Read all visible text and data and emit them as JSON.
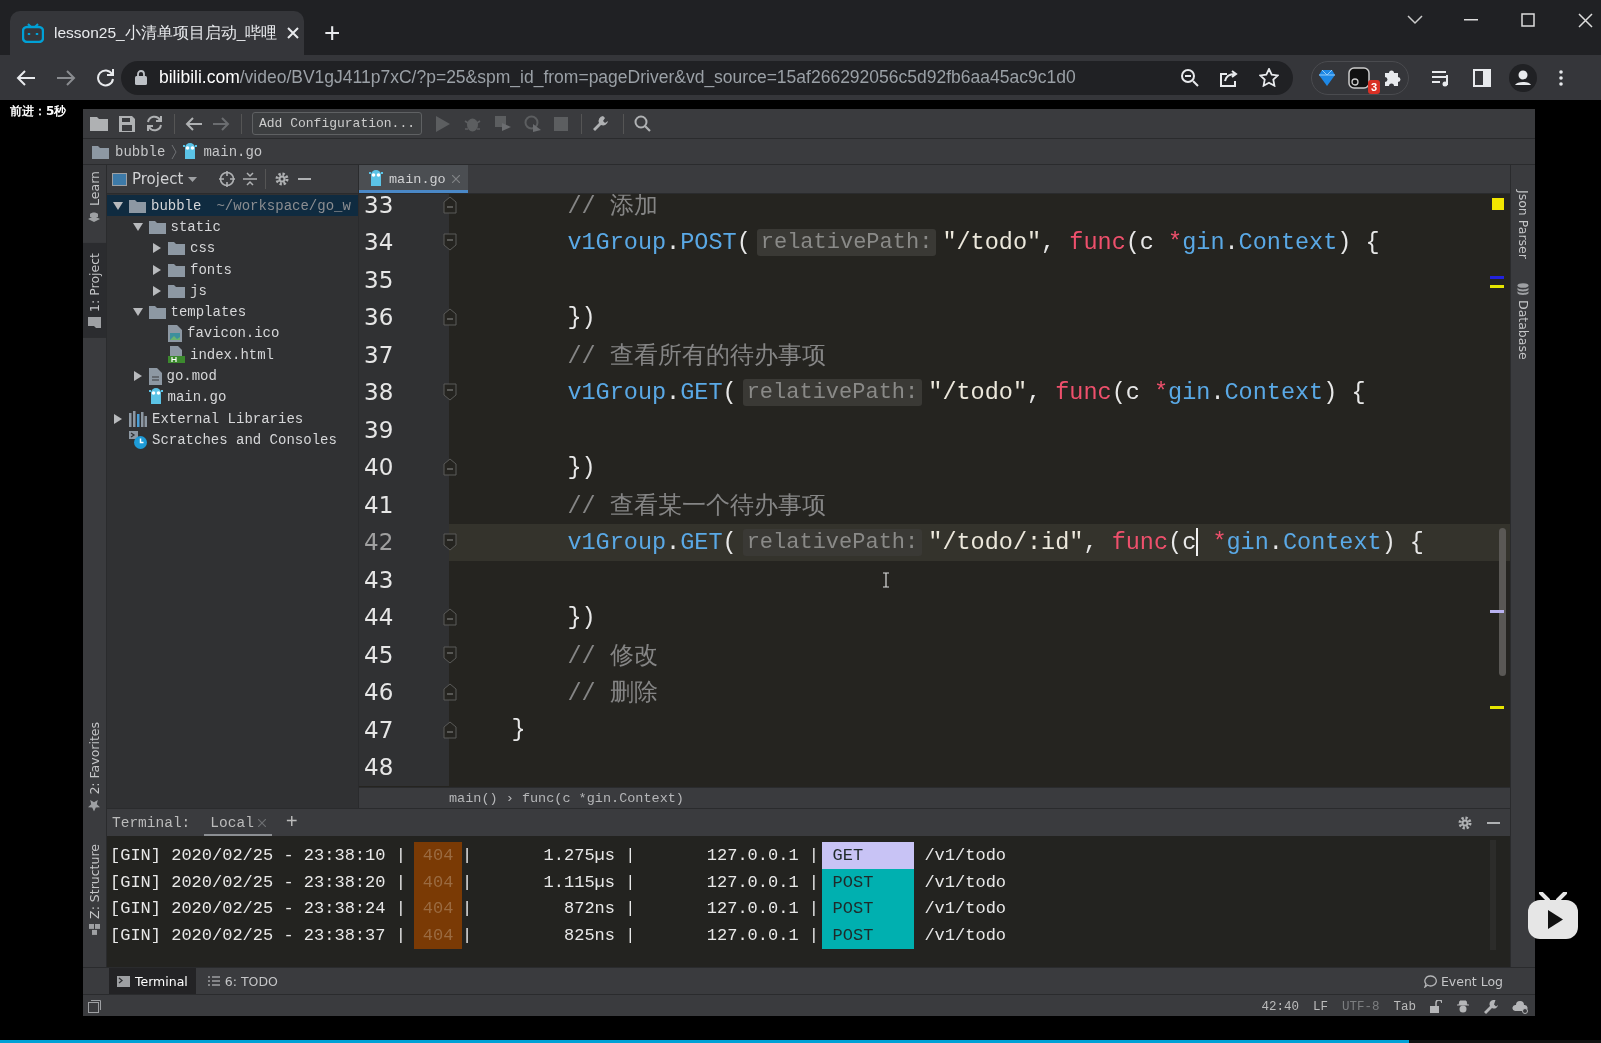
{
  "browser": {
    "tabs": [
      {
        "title": "lesson25_小清单项目启动_哔哩",
        "selected": true
      }
    ],
    "new_tab": "+",
    "address": {
      "domain": "bilibili.com",
      "path": "/video/BV1gJ411p7xC/?p=25&spm_id_from=pageDriver&vd_source=15af266292056c5d92fb6aa45ac9c1d0"
    },
    "extension_badge": "3"
  },
  "player": {
    "seek_hint": "前进：5秒",
    "progress": {
      "level": 0.88
    }
  },
  "ide": {
    "toolbar": {
      "run_config": "Add Configuration..."
    },
    "breadcrumb": [
      "bubble",
      "main.go"
    ],
    "left_tools_top": [
      {
        "label": "Learn",
        "selected": false
      },
      {
        "label": "1: Project",
        "selected": true
      }
    ],
    "left_tools_bottom": [
      {
        "label": "2: Favorites",
        "selected": false
      },
      {
        "label": "Z: Structure",
        "selected": false
      }
    ],
    "right_tools": [
      "Json Parser",
      "Database"
    ],
    "project": {
      "title": "Project",
      "tree": [
        {
          "name": "bubble",
          "kind": "folder",
          "path": "~/workspace/go_w",
          "expanded": true,
          "selected": true,
          "children": [
            {
              "name": "static",
              "kind": "folder",
              "expanded": true,
              "selected": false,
              "children": [
                {
                  "name": "css",
                  "kind": "folder",
                  "expanded": false,
                  "selected": false
                },
                {
                  "name": "fonts",
                  "kind": "folder",
                  "expanded": false,
                  "selected": false
                },
                {
                  "name": "js",
                  "kind": "folder",
                  "expanded": false,
                  "selected": false
                }
              ]
            },
            {
              "name": "templates",
              "kind": "folder",
              "expanded": true,
              "selected": false,
              "children": [
                {
                  "name": "favicon.ico",
                  "kind": "image",
                  "selected": false
                },
                {
                  "name": "index.html",
                  "kind": "html",
                  "selected": false
                }
              ]
            },
            {
              "name": "go.mod",
              "kind": "mod",
              "expanded": false,
              "selected": false
            },
            {
              "name": "main.go",
              "kind": "go",
              "selected": false
            }
          ]
        },
        {
          "name": "External Libraries",
          "kind": "library",
          "expanded": false,
          "selected": false
        },
        {
          "name": "Scratches and Consoles",
          "kind": "scratches",
          "selected": false
        }
      ]
    },
    "editor": {
      "tabs": [
        {
          "label": "main.go",
          "selected": true
        }
      ],
      "lines": [
        {
          "number": "33",
          "current": false,
          "fold_start": false,
          "fold_end": true,
          "kind": "nested",
          "tokens": [
            {
              "kind": "comment",
              "text": "// 添加"
            }
          ]
        },
        {
          "number": "34",
          "current": false,
          "fold_start": true,
          "fold_end": false,
          "kind": "nested",
          "tokens": [
            {
              "kind": "ident",
              "text": "v1Group"
            },
            {
              "kind": "punct",
              "text": "."
            },
            {
              "kind": "ident",
              "text": "POST"
            },
            {
              "kind": "punct",
              "text": "("
            },
            {
              "kind": "hint",
              "text": "relativePath:"
            },
            {
              "kind": "string",
              "text": "\"/todo\""
            },
            {
              "kind": "punct",
              "text": ", "
            },
            {
              "kind": "keyword",
              "text": "func"
            },
            {
              "kind": "punct",
              "text": "("
            },
            {
              "kind": "param",
              "text": "c "
            },
            {
              "kind": "keyword",
              "text": "*"
            },
            {
              "kind": "ident",
              "text": "gin"
            },
            {
              "kind": "punct",
              "text": "."
            },
            {
              "kind": "ident",
              "text": "Context"
            },
            {
              "kind": "punct",
              "text": ") {"
            }
          ]
        },
        {
          "number": "35",
          "current": false,
          "fold_start": false,
          "fold_end": false
        },
        {
          "number": "36",
          "current": false,
          "fold_start": false,
          "fold_end": true,
          "kind": "nested",
          "tokens": [
            {
              "kind": "punct",
              "text": "})"
            }
          ]
        },
        {
          "number": "37",
          "current": false,
          "fold_start": false,
          "fold_end": false,
          "kind": "nested",
          "tokens": [
            {
              "kind": "comment",
              "text": "// 查看所有的待办事项"
            }
          ]
        },
        {
          "number": "38",
          "current": false,
          "fold_start": true,
          "fold_end": false,
          "kind": "nested",
          "tokens": [
            {
              "kind": "ident",
              "text": "v1Group"
            },
            {
              "kind": "punct",
              "text": "."
            },
            {
              "kind": "ident",
              "text": "GET"
            },
            {
              "kind": "punct",
              "text": "("
            },
            {
              "kind": "hint",
              "text": "relativePath:"
            },
            {
              "kind": "string",
              "text": "\"/todo\""
            },
            {
              "kind": "punct",
              "text": ", "
            },
            {
              "kind": "keyword",
              "text": "func"
            },
            {
              "kind": "punct",
              "text": "("
            },
            {
              "kind": "param",
              "text": "c "
            },
            {
              "kind": "keyword",
              "text": "*"
            },
            {
              "kind": "ident",
              "text": "gin"
            },
            {
              "kind": "punct",
              "text": "."
            },
            {
              "kind": "ident",
              "text": "Context"
            },
            {
              "kind": "punct",
              "text": ") {"
            }
          ]
        },
        {
          "number": "39",
          "current": false,
          "fold_start": false,
          "fold_end": false
        },
        {
          "number": "40",
          "current": false,
          "fold_start": false,
          "fold_end": true,
          "kind": "nested",
          "tokens": [
            {
              "kind": "punct",
              "text": "})"
            }
          ]
        },
        {
          "number": "41",
          "current": false,
          "fold_start": false,
          "fold_end": false,
          "kind": "nested",
          "tokens": [
            {
              "kind": "comment",
              "text": "// 查看某一个待办事项"
            }
          ]
        },
        {
          "number": "42",
          "current": true,
          "fold_start": true,
          "fold_end": false,
          "kind": "nested",
          "tokens": [
            {
              "kind": "ident",
              "text": "v1Group"
            },
            {
              "kind": "punct",
              "text": "."
            },
            {
              "kind": "ident",
              "text": "GET"
            },
            {
              "kind": "punct",
              "text": "("
            },
            {
              "kind": "hint",
              "text": "relativePath:"
            },
            {
              "kind": "string",
              "text": "\"/todo/:id\""
            },
            {
              "kind": "punct",
              "text": ", "
            },
            {
              "kind": "keyword",
              "text": "func"
            },
            {
              "kind": "punct",
              "text": "("
            },
            {
              "kind": "param",
              "text": "c",
              "caret": true
            },
            {
              "kind": "keyword",
              "text": " *"
            },
            {
              "kind": "ident",
              "text": "gin"
            },
            {
              "kind": "punct",
              "text": "."
            },
            {
              "kind": "ident",
              "text": "Context"
            },
            {
              "kind": "punct",
              "text": ") {"
            }
          ]
        },
        {
          "number": "43",
          "current": false,
          "fold_start": false,
          "fold_end": false
        },
        {
          "number": "44",
          "current": false,
          "fold_start": false,
          "fold_end": true,
          "kind": "nested",
          "tokens": [
            {
              "kind": "punct",
              "text": "})"
            }
          ]
        },
        {
          "number": "45",
          "current": false,
          "fold_start": true,
          "fold_end": false,
          "kind": "nested",
          "tokens": [
            {
              "kind": "comment",
              "text": "// 修改"
            }
          ]
        },
        {
          "number": "46",
          "current": false,
          "fold_start": false,
          "fold_end": true,
          "kind": "nested",
          "tokens": [
            {
              "kind": "comment",
              "text": "// 删除"
            }
          ]
        },
        {
          "number": "47",
          "current": false,
          "fold_start": false,
          "fold_end": true,
          "kind": "top",
          "tokens": [
            {
              "kind": "punct",
              "text": "}"
            }
          ]
        },
        {
          "number": "48",
          "current": false,
          "fold_start": false,
          "fold_end": false
        }
      ],
      "breadcrumb": "main() › func(c *gin.Context)"
    },
    "terminal": {
      "title": "Terminal:",
      "tabs": [
        {
          "label": "Local",
          "selected": true
        }
      ],
      "add": "+",
      "rows": [
        {
          "head": "[GIN] 2020/02/25 - 23:38:10 |",
          "status": "404",
          "mid": "|       1.275µs |       127.0.0.1 |",
          "method": "GET",
          "color": "#c8c3f5",
          "path": "/v1/todo"
        },
        {
          "head": "[GIN] 2020/02/25 - 23:38:20 |",
          "status": "404",
          "mid": "|       1.115µs |       127.0.0.1 |",
          "method": "POST",
          "color": "#00b0b0",
          "path": "/v1/todo"
        },
        {
          "head": "[GIN] 2020/02/25 - 23:38:24 |",
          "status": "404",
          "mid": "|         872ns |       127.0.0.1 |",
          "method": "POST",
          "color": "#00b0b0",
          "path": "/v1/todo"
        },
        {
          "head": "[GIN] 2020/02/25 - 23:38:37 |",
          "status": "404",
          "mid": "|         825ns |       127.0.0.1 |",
          "method": "POST",
          "color": "#00b0b0",
          "path": "/v1/todo"
        }
      ]
    },
    "tool_tabs": [
      {
        "label": "Terminal",
        "selected": true
      },
      {
        "label": "6: TODO",
        "selected": false
      }
    ],
    "event_log": "Event Log",
    "status": {
      "position": "42:40",
      "line_separator": "LF",
      "encoding": "UTF-8",
      "indent": "Tab"
    }
  }
}
